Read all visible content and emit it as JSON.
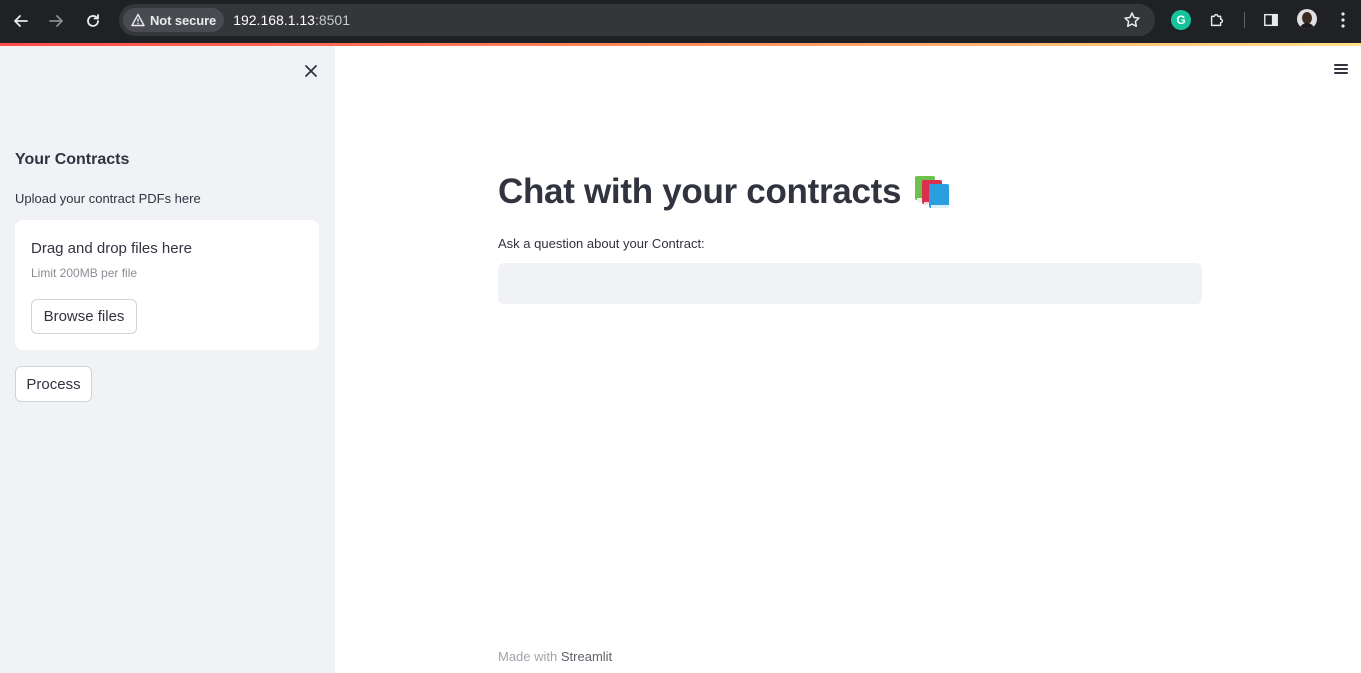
{
  "browser": {
    "security_label": "Not secure",
    "url_host": "192.168.1.13",
    "url_port": ":8501",
    "icons": [
      "back-icon",
      "forward-icon",
      "reload-icon",
      "warning-icon",
      "star-icon",
      "grammarly-icon",
      "puzzle-icon",
      "side-panel-icon",
      "avatar",
      "kebab-menu-icon"
    ],
    "grammarly_letter": "G"
  },
  "sidebar": {
    "title": "Your Contracts",
    "subtitle": "Upload your contract PDFs here",
    "uploader": {
      "title": "Drag and drop files here",
      "limit": "Limit 200MB per file",
      "browse_label": "Browse files"
    },
    "process_label": "Process"
  },
  "main": {
    "title": "Chat with your contracts",
    "question_label": "Ask a question about your Contract:",
    "question_value": "",
    "footer_prefix": "Made with ",
    "footer_brand": "Streamlit"
  },
  "colors": {
    "accent_red": "#ff4b4b",
    "sidebar_bg": "#f0f2f6",
    "text": "#31333f"
  }
}
